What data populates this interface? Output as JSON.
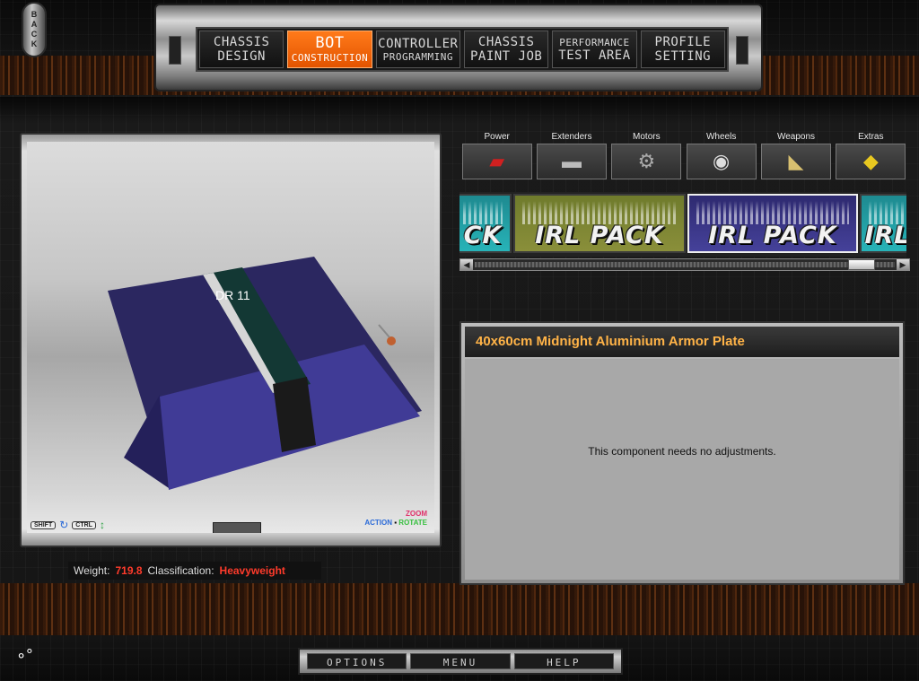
{
  "back_button": {
    "label": "BACK"
  },
  "top_nav": {
    "items": [
      {
        "line1": "CHASSIS",
        "line2": "DESIGN",
        "active": false
      },
      {
        "line1": "BOT",
        "line2": "CONSTRUCTION",
        "active": true
      },
      {
        "line1": "CONTROLLER",
        "line2": "PROGRAMMING",
        "active": false
      },
      {
        "line1": "CHASSIS",
        "line2": "PAINT JOB",
        "active": false
      },
      {
        "line1": "PERFORMANCE",
        "line2": "TEST AREA",
        "active": false
      },
      {
        "line1": "PROFILE",
        "line2": "SETTING",
        "active": false
      }
    ]
  },
  "viewport": {
    "controls": {
      "shift": "SHIFT",
      "ctrl": "CTRL"
    },
    "legend": {
      "zoom": "ZOOM",
      "action": "ACTION",
      "rotate": "ROTATE"
    },
    "model_label": "DR 11"
  },
  "status": {
    "weight_label": "Weight:",
    "weight_value": "719.8",
    "class_label": "Classification:",
    "class_value": "Heavyweight"
  },
  "categories": [
    {
      "name": "Power",
      "icon": "power-icon"
    },
    {
      "name": "Extenders",
      "icon": "extender-icon"
    },
    {
      "name": "Motors",
      "icon": "motor-icon"
    },
    {
      "name": "Wheels",
      "icon": "wheel-icon"
    },
    {
      "name": "Weapons",
      "icon": "weapon-icon"
    },
    {
      "name": "Extras",
      "icon": "extras-icon"
    }
  ],
  "packs": [
    {
      "text": "CK",
      "style": "teal"
    },
    {
      "text": "IRL PACK",
      "style": "olive"
    },
    {
      "text": "IRL PACK",
      "style": "violet"
    },
    {
      "text": "IRL",
      "style": "teal"
    }
  ],
  "info": {
    "title": "40x60cm Midnight Aluminium Armor Plate",
    "message": "This component needs no adjustments."
  },
  "bottom_nav": {
    "items": [
      "OPTIONS",
      "MENU",
      "HELP"
    ]
  }
}
